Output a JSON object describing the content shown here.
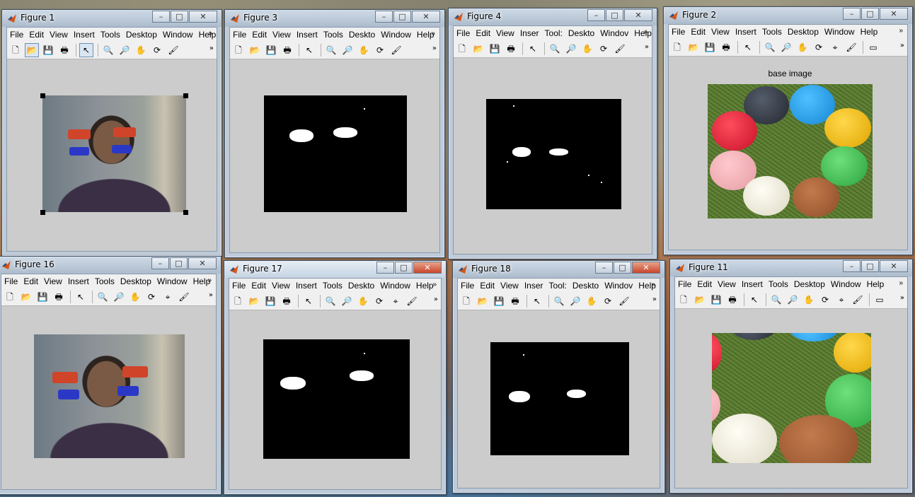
{
  "menu": [
    "File",
    "Edit",
    "View",
    "Insert",
    "Tools",
    "Desktop",
    "Window",
    "Help"
  ],
  "menu_truncated_a": [
    "File",
    "Edit",
    "View",
    "Insert",
    "Tools",
    "Desktop",
    "Window",
    "Help"
  ],
  "menu_truncated_b": [
    "File",
    "Edit",
    "View",
    "Inser",
    "Tool:",
    "Deskto",
    "Windov",
    "Help"
  ],
  "menu_truncated_c": [
    "File",
    "Edit",
    "View",
    "Insert",
    "Tools",
    "Desktop",
    "Window",
    "Help"
  ],
  "menu_truncated_d": [
    "File",
    "Edit",
    "View",
    "Insert",
    "Tools",
    "Deskto",
    "Windov",
    "Help"
  ],
  "title_buttons": {
    "minimize": "–",
    "maximize": "□",
    "close": "✕"
  },
  "figures": [
    {
      "title": "Figure 1"
    },
    {
      "title": "Figure 3"
    },
    {
      "title": "Figure 4"
    },
    {
      "title": "Figure 2",
      "axes_title": "base image"
    },
    {
      "title": "Figure 16"
    },
    {
      "title": "Figure 17"
    },
    {
      "title": "Figure 18"
    },
    {
      "title": "Figure 11"
    }
  ],
  "toolbar_icons": [
    "new-file-icon",
    "open-folder-icon",
    "save-icon",
    "print-icon",
    "pointer-icon",
    "zoom-in-icon",
    "zoom-out-icon",
    "pan-hand-icon",
    "rotate-3d-icon",
    "data-cursor-icon",
    "brush-icon",
    "dock-icon"
  ],
  "colors": {
    "figure_bg": "#cccccc",
    "window_frame": "#bfcbd9",
    "menu_bg": "#f0f0f0",
    "close_active": "#c9452a",
    "mask_bg": "#000000",
    "mask_fg": "#ffffff"
  }
}
